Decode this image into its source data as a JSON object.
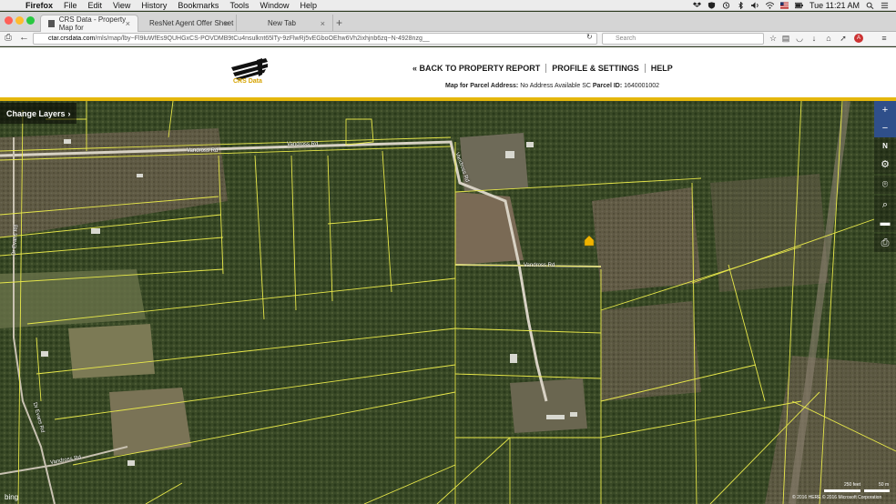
{
  "menubar": {
    "app": "Firefox",
    "items": [
      "File",
      "Edit",
      "View",
      "History",
      "Bookmarks",
      "Tools",
      "Window",
      "Help"
    ],
    "clock": "Tue 11:21 AM"
  },
  "tabs": [
    {
      "title": "CRS Data - Property Map for"
    },
    {
      "title": "ResNet Agent Offer Sheet"
    },
    {
      "title": "New Tab"
    }
  ],
  "nav": {
    "url_host": "ctar.crsdata.com",
    "url_path": "/mls/map/lby~Fl9luWfEs9QUHGxCS-POVDMB9tCu4nsulknt65lTy-9zFlwRj5vEGboOEhw6Vh2ixhjnb6zq~N-4928nzg__",
    "search_placeholder": "Search"
  },
  "header": {
    "logo_text": "CRS Data",
    "back_link": "« BACK TO PROPERTY REPORT",
    "profile_link": "PROFILE & SETTINGS",
    "help_link": "HELP",
    "parcel_prefix": "Map for Parcel Address:",
    "parcel_address": "No Address Available SC",
    "parcel_id_label": "Parcel ID:",
    "parcel_id": "1640001002"
  },
  "map": {
    "layers_button": "Change Layers",
    "provider": "bing",
    "scale_feet": "250 feet",
    "scale_m": "50 m",
    "copyright": "© 2016 HERE   © 2016 Microsoft Corporation",
    "road_labels": [
      "Vandross Rd",
      "Vandross Rd",
      "Vandross Rd",
      "Vandross Rd",
      "Dr Evans Rd",
      "Dr Evans Rd",
      "Vandross Rd"
    ],
    "tools": [
      "zoom-in",
      "zoom-out",
      "north",
      "settings",
      "location",
      "search",
      "measure",
      "print"
    ],
    "colors": {
      "parcel_lines": "#e8e84a",
      "toolbar": "#2f4f8a",
      "header_accent": "#e5b70c"
    }
  }
}
